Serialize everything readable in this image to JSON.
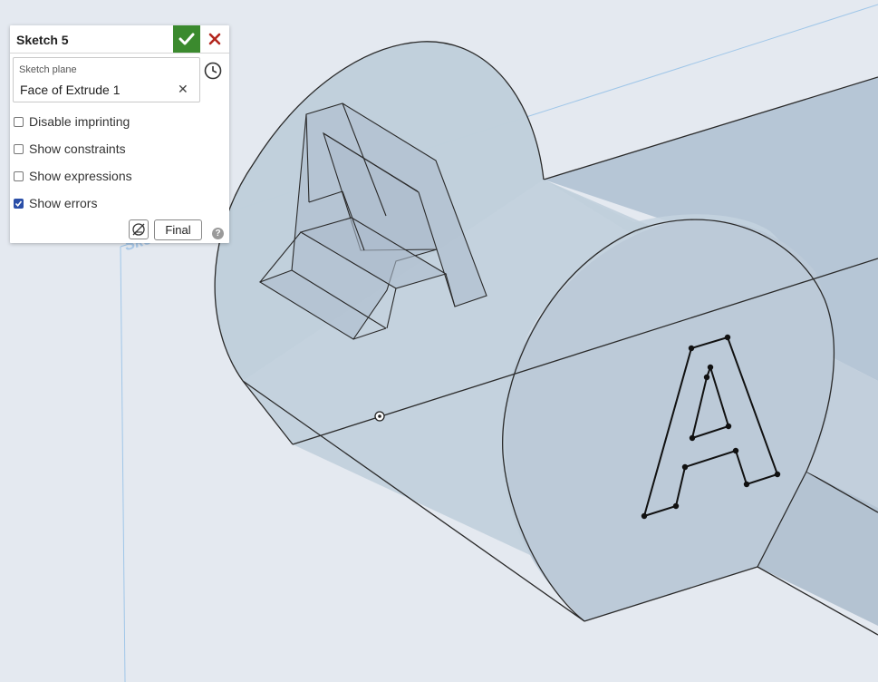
{
  "viewport": {
    "plane_label": "Sketch 5",
    "sketch_letter": "A",
    "colors": {
      "background": "#e4e9f0",
      "solid_face": "#b8c7d6",
      "edge": "#2a2a2a",
      "plane": "#9fc6e8"
    }
  },
  "sketch_panel": {
    "title": "Sketch 5",
    "ok_icon": "checkmark-icon",
    "cancel_icon": "close-icon",
    "sketch_plane": {
      "label": "Sketch plane",
      "value": "Face of Extrude 1",
      "clear_symbol": "✕"
    },
    "history_icon": "clock-history-icon",
    "options": [
      {
        "label": "Disable imprinting",
        "checked": false
      },
      {
        "label": "Show constraints",
        "checked": false
      },
      {
        "label": "Show expressions",
        "checked": false
      },
      {
        "label": "Show errors",
        "checked": true
      }
    ],
    "display_icon": "sketch-display-icon",
    "final_label": "Final",
    "help_symbol": "?"
  }
}
